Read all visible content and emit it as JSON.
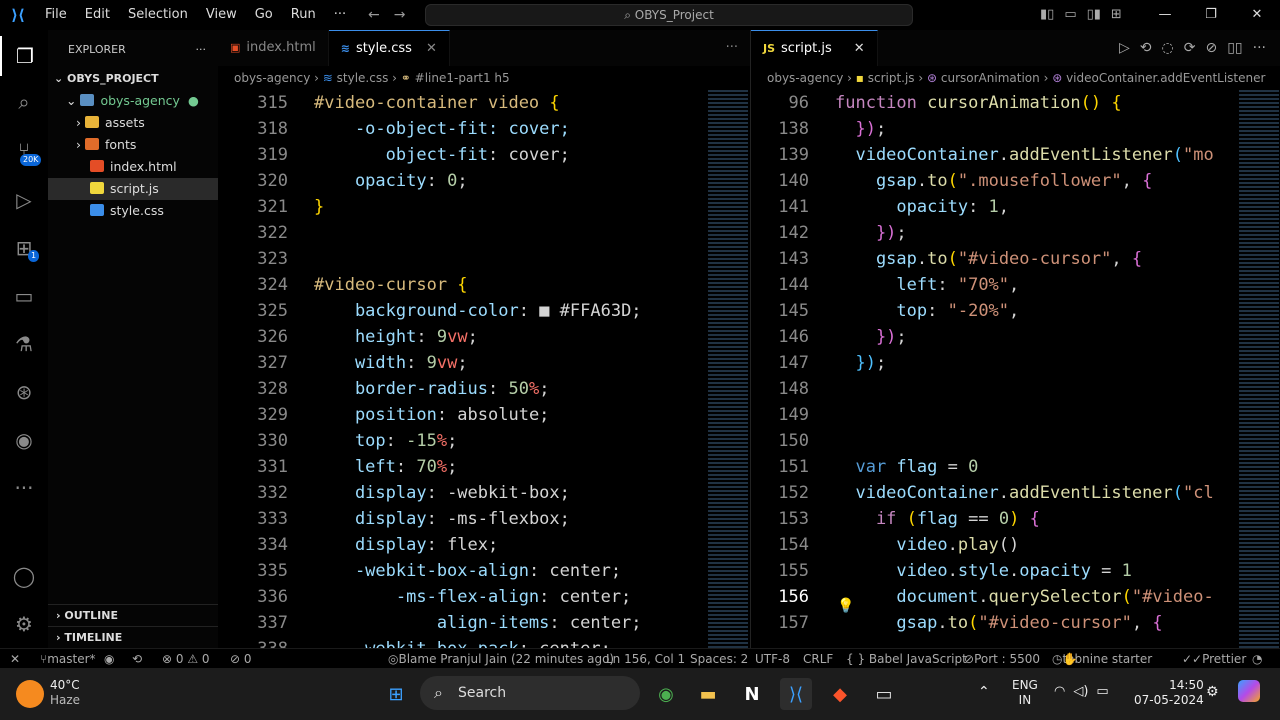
{
  "titlebar": {
    "menu": [
      "File",
      "Edit",
      "Selection",
      "View",
      "Go",
      "Run",
      "···"
    ],
    "search": "OBYS_Project"
  },
  "activity": {
    "scm_badge": "20K",
    "ext_badge": "1"
  },
  "sidebar": {
    "title": "EXPLORER",
    "project": "OBYS_PROJECT",
    "items": [
      {
        "label": "obys-agency",
        "kind": "folder-open"
      },
      {
        "label": "assets",
        "kind": "folder"
      },
      {
        "label": "fonts",
        "kind": "folder"
      },
      {
        "label": "index.html",
        "kind": "html"
      },
      {
        "label": "script.js",
        "kind": "js"
      },
      {
        "label": "style.css",
        "kind": "css"
      }
    ],
    "outline": "OUTLINE",
    "timeline": "TIMELINE"
  },
  "left_editor": {
    "tabs": [
      "index.html",
      "style.css"
    ],
    "breadcrumb": [
      "obys-agency",
      "style.css",
      "#line1-part1 h5"
    ],
    "lines": [
      {
        "n": "315",
        "code": [
          [
            "sel-c",
            "#video-container video "
          ],
          [
            "br",
            "{"
          ]
        ]
      },
      {
        "n": "318",
        "code": [
          [
            "prop",
            "    -o-object-fit: cover;"
          ]
        ]
      },
      {
        "n": "319",
        "code": [
          [
            "prop",
            "       object-fit"
          ],
          [
            "plain",
            ": "
          ],
          [
            "plain",
            "cover;"
          ]
        ]
      },
      {
        "n": "320",
        "code": [
          [
            "prop",
            "    opacity"
          ],
          [
            "plain",
            ": "
          ],
          [
            "num",
            "0"
          ],
          [
            "plain",
            ";"
          ]
        ]
      },
      {
        "n": "321",
        "code": [
          [
            "br",
            "}"
          ]
        ]
      },
      {
        "n": "322",
        "code": []
      },
      {
        "n": "323",
        "code": []
      },
      {
        "n": "324",
        "code": [
          [
            "sel-c",
            "#video-cursor "
          ],
          [
            "br",
            "{"
          ]
        ]
      },
      {
        "n": "325",
        "code": [
          [
            "prop",
            "    background-color"
          ],
          [
            "plain",
            ": "
          ],
          [
            "plain",
            "■ #FFA63D;"
          ]
        ]
      },
      {
        "n": "326",
        "code": [
          [
            "prop",
            "    height"
          ],
          [
            "plain",
            ": "
          ],
          [
            "num",
            "9"
          ],
          [
            "unit",
            "vw"
          ],
          [
            "plain",
            ";"
          ]
        ]
      },
      {
        "n": "327",
        "code": [
          [
            "prop",
            "    width"
          ],
          [
            "plain",
            ": "
          ],
          [
            "num",
            "9"
          ],
          [
            "unit",
            "vw"
          ],
          [
            "plain",
            ";"
          ]
        ]
      },
      {
        "n": "328",
        "code": [
          [
            "prop",
            "    border-radius"
          ],
          [
            "plain",
            ": "
          ],
          [
            "num",
            "50"
          ],
          [
            "unit",
            "%"
          ],
          [
            "plain",
            ";"
          ]
        ]
      },
      {
        "n": "329",
        "code": [
          [
            "prop",
            "    position"
          ],
          [
            "plain",
            ": absolute;"
          ]
        ]
      },
      {
        "n": "330",
        "code": [
          [
            "prop",
            "    top"
          ],
          [
            "plain",
            ": "
          ],
          [
            "num",
            "-15"
          ],
          [
            "unit",
            "%"
          ],
          [
            "plain",
            ";"
          ]
        ]
      },
      {
        "n": "331",
        "code": [
          [
            "prop",
            "    left"
          ],
          [
            "plain",
            ": "
          ],
          [
            "num",
            "70"
          ],
          [
            "unit",
            "%"
          ],
          [
            "plain",
            ";"
          ]
        ]
      },
      {
        "n": "332",
        "code": [
          [
            "prop",
            "    display"
          ],
          [
            "plain",
            ": -webkit-box;"
          ]
        ]
      },
      {
        "n": "333",
        "code": [
          [
            "prop",
            "    display"
          ],
          [
            "plain",
            ": -ms-flexbox;"
          ]
        ]
      },
      {
        "n": "334",
        "code": [
          [
            "prop",
            "    display"
          ],
          [
            "plain",
            ": flex;"
          ]
        ]
      },
      {
        "n": "335",
        "code": [
          [
            "prop",
            "    -webkit-box-align"
          ],
          [
            "plain",
            ": center;"
          ]
        ]
      },
      {
        "n": "336",
        "code": [
          [
            "prop",
            "        -ms-flex-align"
          ],
          [
            "plain",
            ": center;"
          ]
        ]
      },
      {
        "n": "337",
        "code": [
          [
            "prop",
            "            align-items"
          ],
          [
            "plain",
            ": center;"
          ]
        ]
      },
      {
        "n": "338",
        "code": [
          [
            "prop",
            "    -webkit-box-pack"
          ],
          [
            "plain",
            ": center;"
          ]
        ]
      }
    ]
  },
  "right_editor": {
    "tabs": [
      "script.js"
    ],
    "breadcrumb": [
      "obys-agency",
      "script.js",
      "cursorAnimation",
      "videoContainer.addEventListener"
    ],
    "lines": [
      {
        "n": "96",
        "code": [
          [
            "kw",
            "function "
          ],
          [
            "fn",
            "cursorAnimation"
          ],
          [
            "br",
            "() {"
          ]
        ]
      },
      {
        "n": "138",
        "code": [
          [
            "br2",
            "  })"
          ],
          [
            "plain",
            ";"
          ]
        ]
      },
      {
        "n": "139",
        "code": [
          [
            "var",
            "  videoContainer"
          ],
          [
            "plain",
            "."
          ],
          [
            "fn",
            "addEventListener"
          ],
          [
            "br3",
            "("
          ],
          [
            "str",
            "\"mo"
          ]
        ]
      },
      {
        "n": "140",
        "code": [
          [
            "var",
            "    gsap"
          ],
          [
            "plain",
            "."
          ],
          [
            "fn",
            "to"
          ],
          [
            "br",
            "("
          ],
          [
            "str",
            "\".mousefollower\""
          ],
          [
            "plain",
            ", "
          ],
          [
            "br2",
            "{"
          ]
        ]
      },
      {
        "n": "141",
        "code": [
          [
            "var",
            "      opacity"
          ],
          [
            "plain",
            ": "
          ],
          [
            "num",
            "1"
          ],
          [
            "plain",
            ","
          ]
        ]
      },
      {
        "n": "142",
        "code": [
          [
            "br2",
            "    })"
          ],
          [
            "plain",
            ";"
          ]
        ]
      },
      {
        "n": "143",
        "code": [
          [
            "var",
            "    gsap"
          ],
          [
            "plain",
            "."
          ],
          [
            "fn",
            "to"
          ],
          [
            "br",
            "("
          ],
          [
            "str",
            "\"#video-cursor\""
          ],
          [
            "plain",
            ", "
          ],
          [
            "br2",
            "{"
          ]
        ]
      },
      {
        "n": "144",
        "code": [
          [
            "var",
            "      left"
          ],
          [
            "plain",
            ": "
          ],
          [
            "str",
            "\"70%\""
          ],
          [
            "plain",
            ","
          ]
        ]
      },
      {
        "n": "145",
        "code": [
          [
            "var",
            "      top"
          ],
          [
            "plain",
            ": "
          ],
          [
            "str",
            "\"-20%\""
          ],
          [
            "plain",
            ","
          ]
        ]
      },
      {
        "n": "146",
        "code": [
          [
            "br2",
            "    })"
          ],
          [
            "plain",
            ";"
          ]
        ]
      },
      {
        "n": "147",
        "code": [
          [
            "br3",
            "  })"
          ],
          [
            "plain",
            ";"
          ]
        ]
      },
      {
        "n": "148",
        "code": []
      },
      {
        "n": "149",
        "code": []
      },
      {
        "n": "150",
        "code": []
      },
      {
        "n": "151",
        "code": [
          [
            "kwb",
            "  var "
          ],
          [
            "var",
            "flag"
          ],
          [
            "plain",
            " = "
          ],
          [
            "num",
            "0"
          ]
        ]
      },
      {
        "n": "152",
        "code": [
          [
            "var",
            "  videoContainer"
          ],
          [
            "plain",
            "."
          ],
          [
            "fn",
            "addEventListener"
          ],
          [
            "br3",
            "("
          ],
          [
            "str",
            "\"cl"
          ]
        ]
      },
      {
        "n": "153",
        "code": [
          [
            "kw",
            "    if "
          ],
          [
            "br",
            "("
          ],
          [
            "var",
            "flag"
          ],
          [
            "plain",
            " == "
          ],
          [
            "num",
            "0"
          ],
          [
            "br",
            ")"
          ],
          [
            "plain",
            " "
          ],
          [
            "br2",
            "{"
          ]
        ]
      },
      {
        "n": "154",
        "code": [
          [
            "var",
            "      video"
          ],
          [
            "plain",
            "."
          ],
          [
            "fn",
            "play"
          ],
          [
            "plain",
            "()"
          ]
        ]
      },
      {
        "n": "155",
        "code": [
          [
            "var",
            "      video"
          ],
          [
            "plain",
            "."
          ],
          [
            "var",
            "style"
          ],
          [
            "plain",
            "."
          ],
          [
            "var",
            "opacity"
          ],
          [
            "plain",
            " = "
          ],
          [
            "num",
            "1"
          ]
        ]
      },
      {
        "n": "156",
        "code": [
          [
            "var",
            "      document"
          ],
          [
            "plain",
            "."
          ],
          [
            "fn",
            "querySelector"
          ],
          [
            "br",
            "("
          ],
          [
            "str",
            "\"#video-"
          ]
        ]
      },
      {
        "n": "157",
        "code": [
          [
            "var",
            "      gsap"
          ],
          [
            "plain",
            "."
          ],
          [
            "fn",
            "to"
          ],
          [
            "br",
            "("
          ],
          [
            "str",
            "\"#video-cursor\""
          ],
          [
            "plain",
            ", "
          ],
          [
            "br2",
            "{"
          ]
        ]
      }
    ]
  },
  "status": {
    "branch": "master*",
    "errors": "⊗ 0 ⚠ 0",
    "ports_icon": "⊘ 0",
    "blame": "Blame Pranjul Jain (22 minutes ago)",
    "position": "Ln 156, Col 1",
    "spaces": "Spaces: 2",
    "encoding": "UTF-8",
    "eol": "CRLF",
    "language": "{ } Babel JavaScript",
    "port": "Port : 5500",
    "tabnine": "tabnine starter",
    "prettier": "Prettier"
  },
  "taskbar": {
    "weather_temp": "40°C",
    "weather_desc": "Haze",
    "search": "Search",
    "lang1": "ENG",
    "lang2": "IN",
    "time": "14:50",
    "date": "07-05-2024"
  },
  "colors": {
    "accent": "#3b8eea",
    "swatch": "#FFA63D"
  }
}
